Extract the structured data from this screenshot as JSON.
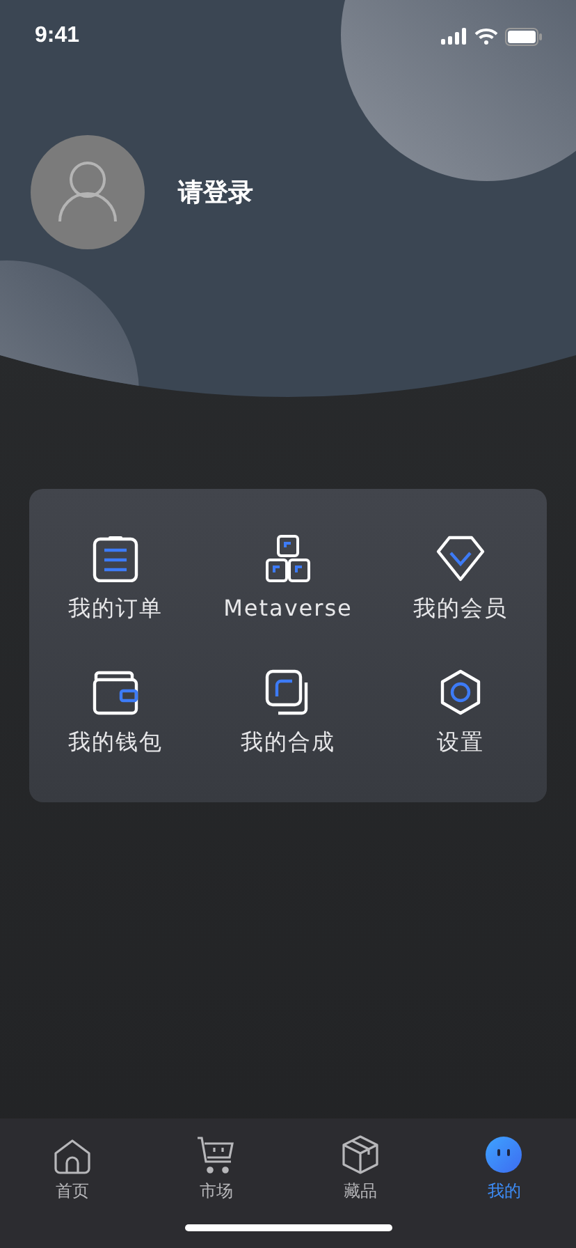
{
  "status_bar": {
    "time": "9:41"
  },
  "profile": {
    "login_prompt": "请登录"
  },
  "menu": [
    {
      "label": "我的订单"
    },
    {
      "label": "Metaverse"
    },
    {
      "label": "我的会员"
    },
    {
      "label": "我的钱包"
    },
    {
      "label": "我的合成"
    },
    {
      "label": "设置"
    }
  ],
  "tab_bar": [
    {
      "label": "首页",
      "selected": false
    },
    {
      "label": "市场",
      "selected": false
    },
    {
      "label": "藏品",
      "selected": false
    },
    {
      "label": "我的",
      "selected": true
    }
  ]
}
